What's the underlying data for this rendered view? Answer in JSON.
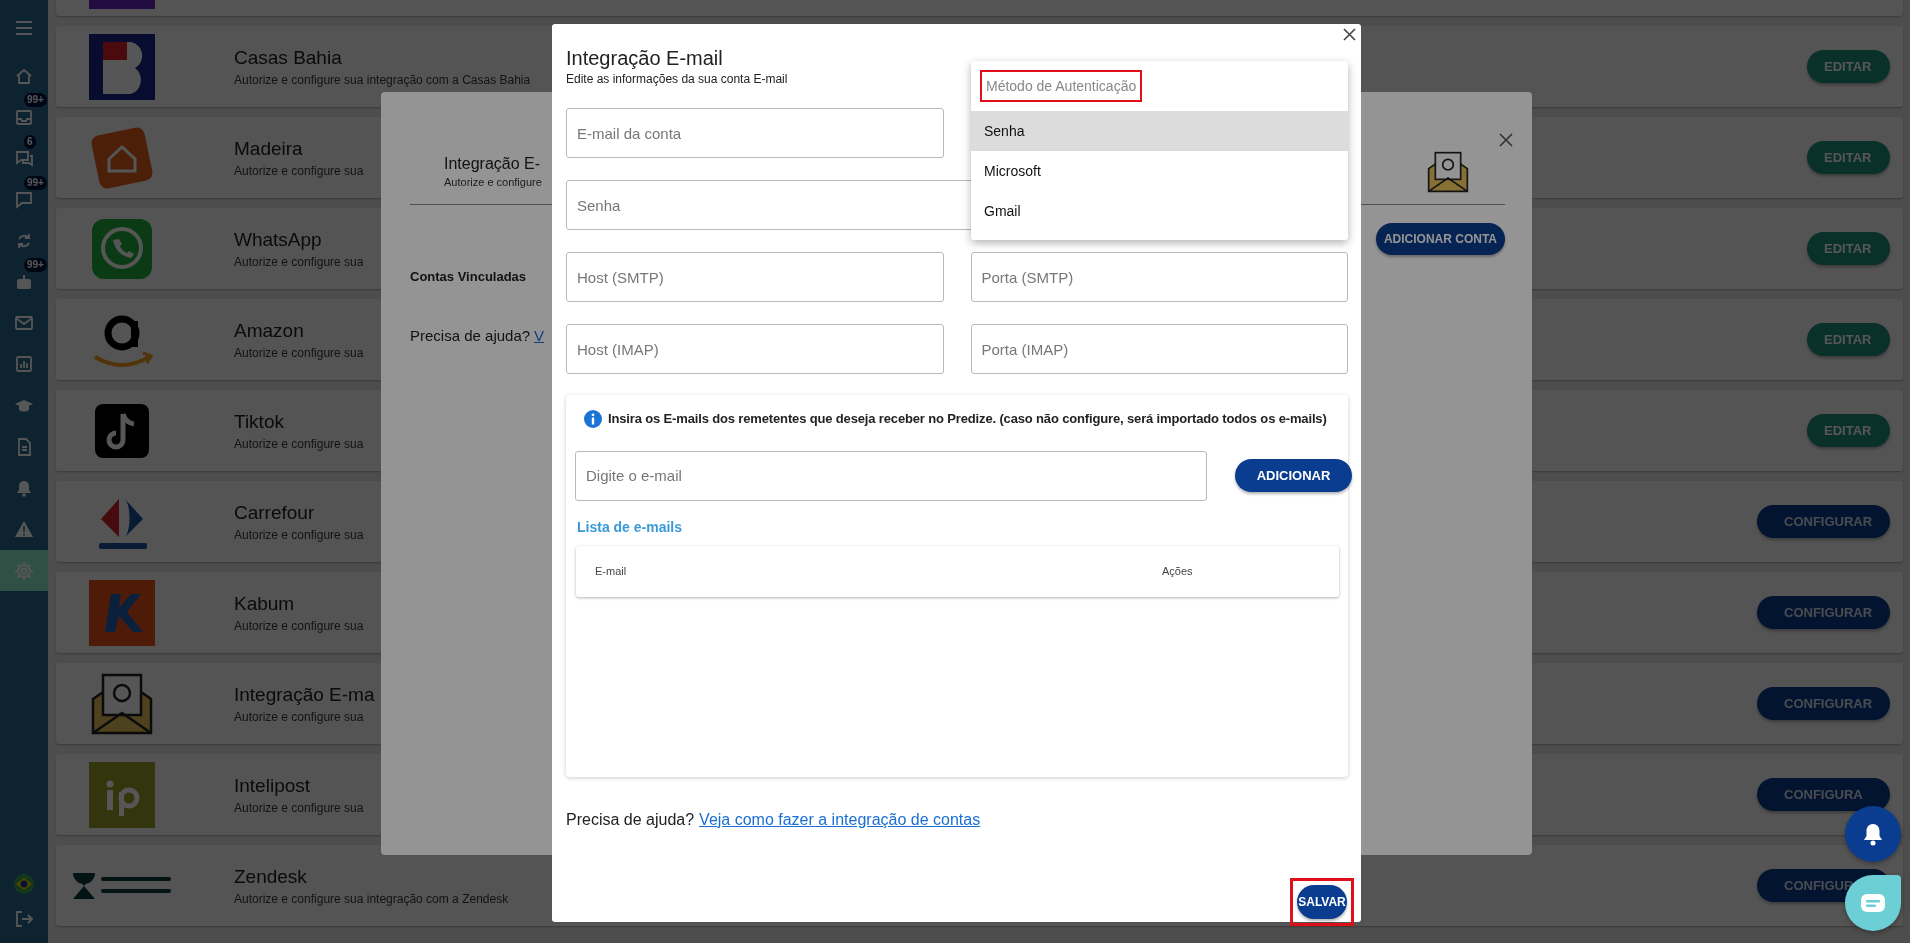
{
  "sidebar": {
    "items": [
      {
        "selected": false
      },
      {
        "badge": "99+",
        "selected": false
      },
      {
        "badge": "6",
        "selected": false
      },
      {
        "badge": "99+",
        "selected": false
      },
      {
        "selected": false
      },
      {
        "badge": "99+",
        "selected": false
      },
      {
        "selected": false
      },
      {
        "selected": false
      },
      {
        "selected": false
      },
      {
        "selected": false
      },
      {
        "selected": false
      },
      {
        "selected": false
      },
      {
        "selected": true
      }
    ]
  },
  "integrations": [
    {
      "title": "Casas Bahia",
      "subtitle": "Autorize e configure sua integração com a Casas Bahia",
      "action": {
        "label": "EDITAR",
        "kind": "edit"
      }
    },
    {
      "title": "Madeira",
      "subtitle": "Autorize e configure sua",
      "action": {
        "label": "EDITAR",
        "kind": "edit"
      }
    },
    {
      "title": "WhatsApp",
      "subtitle": "Autorize e configure sua",
      "action": {
        "label": "EDITAR",
        "kind": "edit"
      }
    },
    {
      "title": "Amazon",
      "subtitle": "Autorize e configure sua",
      "action": {
        "label": "EDITAR",
        "kind": "edit"
      }
    },
    {
      "title": "Tiktok",
      "subtitle": "Autorize e configure sua",
      "action": {
        "label": "EDITAR",
        "kind": "edit"
      }
    },
    {
      "title": "Carrefour",
      "subtitle": "Autorize e configure sua",
      "action": {
        "label": "CONFIGURAR",
        "kind": "configure"
      }
    },
    {
      "title": "Kabum",
      "subtitle": "Autorize e configure sua",
      "action": {
        "label": "CONFIGURAR",
        "kind": "configure"
      }
    },
    {
      "title": "Integração E-ma",
      "subtitle": "Autorize e configure sua",
      "action": {
        "label": "CONFIGURAR",
        "kind": "configure"
      }
    },
    {
      "title": "Intelipost",
      "subtitle": "Autorize e configure sua",
      "action": {
        "label": "CONFIGURA",
        "kind": "configure"
      }
    },
    {
      "title": "Zendesk",
      "subtitle": "Autorize e configure sua integração com a Zendesk",
      "action": {
        "label": "CONFIGUR",
        "kind": "configure"
      }
    }
  ],
  "integration_dialog": {
    "title": "Integração E-",
    "subtitle": "Autorize e configure",
    "linked_accounts": "Contas Vinculadas",
    "add_account_button": "ADICIONAR CONTA",
    "help_text": "Precisa de ajuda?",
    "help_link": "V"
  },
  "email_dialog": {
    "title": "Integração E-mail",
    "subtitle": "Edite as informações da sua conta E-mail",
    "fields": [
      {
        "placeholder": "E-mail da conta",
        "kind": "narrow"
      },
      {
        "placeholder": "Senha",
        "kind": "wide"
      },
      {
        "placeholder": "Host (SMTP)",
        "kind": "narrow"
      },
      {
        "placeholder": "Porta (SMTP)",
        "kind": "narrow"
      },
      {
        "placeholder": "Host (IMAP)",
        "kind": "narrow"
      },
      {
        "placeholder": "Porta (IMAP)",
        "kind": "narrow"
      }
    ],
    "auth_menu": {
      "label": "Método de Autenticação",
      "highlighted": true,
      "options": [
        {
          "label": "Senha",
          "selected": true
        },
        {
          "label": "Microsoft",
          "selected": false
        },
        {
          "label": "Gmail",
          "selected": false
        }
      ]
    },
    "senders": {
      "info": "Insira os E-mails dos remetentes que deseja receber no Predize. (caso não configure, será importado todos os e-mails)",
      "email_input": {
        "placeholder": "Digite o e-mail"
      },
      "add_button": "ADICIONAR",
      "list_title": "Lista de e-mails",
      "columns": [
        "E-mail",
        "Ações"
      ]
    },
    "help_text": "Precisa de ajuda?",
    "help_link": "Veja como fazer a integração de contas",
    "save_button": {
      "label": "SALVAR",
      "highlighted": true
    }
  }
}
